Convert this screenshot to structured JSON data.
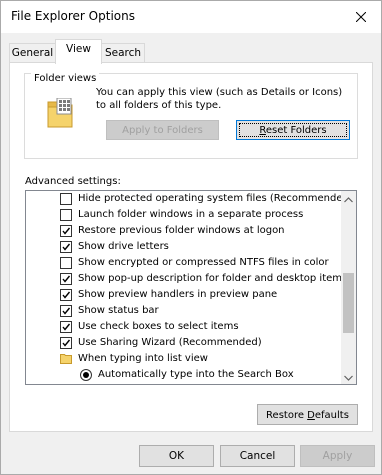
{
  "window": {
    "title": "File Explorer Options"
  },
  "tabs": [
    {
      "label": "General",
      "active": false
    },
    {
      "label": "View",
      "active": true
    },
    {
      "label": "Search",
      "active": false
    }
  ],
  "folder_views": {
    "title": "Folder views",
    "description": "You can apply this view (such as Details or Icons) to all folders of this type.",
    "apply_label": "Apply to Folders",
    "reset_prefix": "",
    "reset_mnemonic": "R",
    "reset_rest": "eset Folders"
  },
  "advanced": {
    "label": "Advanced settings:",
    "items": [
      {
        "type": "checkbox",
        "checked": false,
        "label": "Hide protected operating system files (Recommended)"
      },
      {
        "type": "checkbox",
        "checked": false,
        "label": "Launch folder windows in a separate process"
      },
      {
        "type": "checkbox",
        "checked": true,
        "label": "Restore previous folder windows at logon"
      },
      {
        "type": "checkbox",
        "checked": true,
        "label": "Show drive letters"
      },
      {
        "type": "checkbox",
        "checked": false,
        "label": "Show encrypted or compressed NTFS files in color"
      },
      {
        "type": "checkbox",
        "checked": true,
        "label": "Show pop-up description for folder and desktop items"
      },
      {
        "type": "checkbox",
        "checked": true,
        "label": "Show preview handlers in preview pane"
      },
      {
        "type": "checkbox",
        "checked": true,
        "label": "Show status bar"
      },
      {
        "type": "checkbox",
        "checked": true,
        "label": "Use check boxes to select items"
      },
      {
        "type": "checkbox",
        "checked": true,
        "label": "Use Sharing Wizard (Recommended)"
      },
      {
        "type": "folder",
        "label": "When typing into list view"
      },
      {
        "type": "radio",
        "checked": true,
        "label": "Automatically type into the Search Box"
      }
    ]
  },
  "restore_defaults": {
    "prefix": "Restore ",
    "mnemonic": "D",
    "rest": "efaults"
  },
  "buttons": {
    "ok": "OK",
    "cancel": "Cancel",
    "apply": "Apply"
  },
  "colors": {
    "focus_border": "#0078d7",
    "folder_yellow": "#f5d36b"
  }
}
